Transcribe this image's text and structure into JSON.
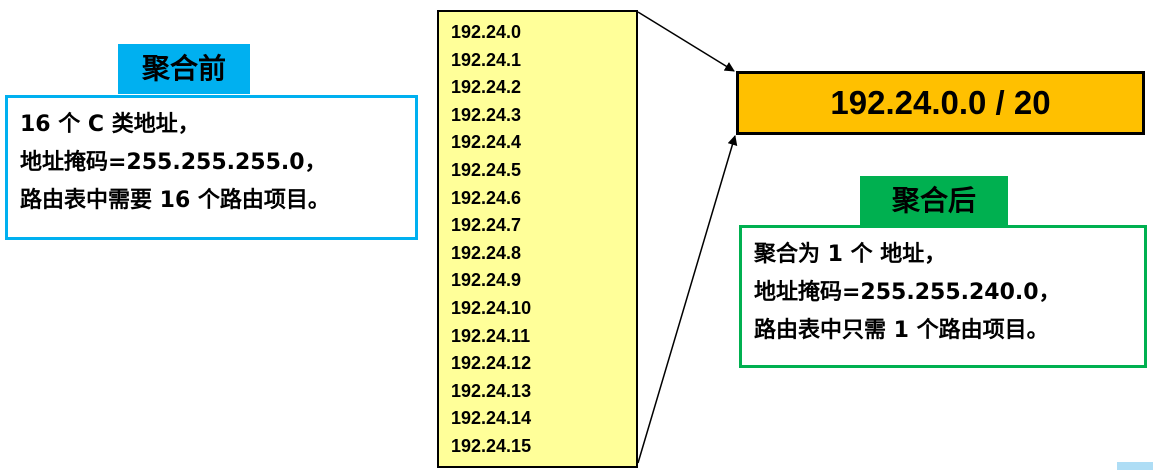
{
  "before": {
    "tag": "聚合前",
    "lines": [
      "16 个 C 类地址，",
      "地址掩码=255.255.255.0，",
      "路由表中需要 16 个路由项目。"
    ]
  },
  "after": {
    "tag": "聚合后",
    "lines": [
      "聚合为 1 个 地址，",
      "地址掩码=255.255.240.0，",
      "路由表中只需 1 个路由项目。"
    ]
  },
  "addresses": [
    "192.24.0",
    "192.24.1",
    "192.24.2",
    "192.24.3",
    "192.24.4",
    "192.24.5",
    "192.24.6",
    "192.24.7",
    "192.24.8",
    "192.24.9",
    "192.24.10",
    "192.24.11",
    "192.24.12",
    "192.24.13",
    "192.24.14",
    "192.24.15"
  ],
  "result": "192.24.0.0 / 20",
  "colors": {
    "before": "#00b0f0",
    "after": "#00b050",
    "list_bg": "#ffff99",
    "result_bg": "#ffc000"
  }
}
